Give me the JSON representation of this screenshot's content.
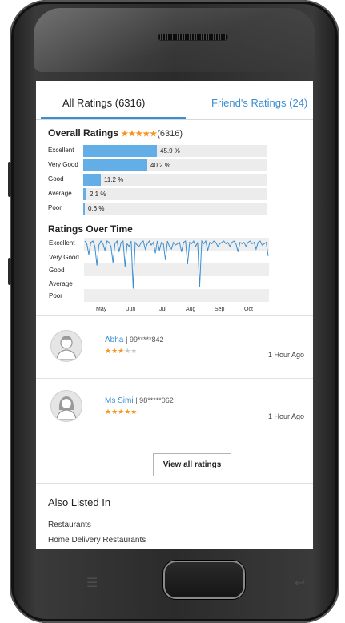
{
  "tabs": {
    "all_ratings": "All Ratings (6316)",
    "friends_ratings": "Friend's Ratings (24)"
  },
  "overall": {
    "title": "Overall Ratings",
    "stars": "★★★★★",
    "count": "(6316)",
    "bars": [
      {
        "label": "Excellent",
        "value": 45.9,
        "value_text": "45.9 %"
      },
      {
        "label": "Very Good",
        "value": 40.2,
        "value_text": "40.2 %"
      },
      {
        "label": "Good",
        "value": 11.2,
        "value_text": "11.2 %"
      },
      {
        "label": "Average",
        "value": 2.1,
        "value_text": "2.1 %"
      },
      {
        "label": "Poor",
        "value": 0.6,
        "value_text": "0.6 %"
      }
    ]
  },
  "over_time": {
    "title": "Ratings Over Time",
    "levels": [
      "Excellent",
      "Very Good",
      "Good",
      "Average",
      "Poor"
    ],
    "months": [
      "May",
      "Jun",
      "Jul",
      "Aug",
      "Sep",
      "Oct"
    ]
  },
  "chart_data": {
    "type": "line",
    "title": "Ratings Over Time",
    "x_tick_labels": [
      "May",
      "Jun",
      "Jul",
      "Aug",
      "Sep",
      "Oct"
    ],
    "y_categories": [
      "Poor",
      "Average",
      "Good",
      "Very Good",
      "Excellent"
    ],
    "series": [
      {
        "values": [
          5,
          4.8,
          4,
          4.9,
          5,
          4.6,
          3.2,
          4.7,
          5,
          4.8,
          4.3,
          5,
          4.9,
          4.6,
          3.4,
          4.8,
          5,
          4.2,
          4.9,
          5,
          3.1,
          4.8,
          4.6,
          5,
          1.5,
          4.9,
          4.7,
          4.6,
          4.9,
          5,
          4.4,
          4.8,
          5,
          4.7,
          4.9,
          4.1,
          5,
          4.3,
          4.9,
          4.8,
          3.6,
          5,
          4.6,
          4.4,
          4.9,
          4.7,
          4.8,
          4.9,
          4.2,
          4.9,
          5,
          3.3,
          4.9,
          4.8,
          5,
          4.6,
          4.9,
          1.6,
          5,
          4.8,
          5,
          4.3,
          4.9,
          4.8,
          5,
          4.9,
          4.6,
          4.8,
          4.9,
          5,
          4.8,
          4.9,
          4.6,
          4.9,
          5,
          4.8,
          4.2,
          4.9,
          4.8,
          4.9,
          4.6,
          4.9,
          5,
          4.8,
          4.9,
          4.4,
          4.9,
          5,
          4.7,
          4.8,
          4.9,
          3.9
        ]
      }
    ]
  },
  "reviews": [
    {
      "name": "Abha",
      "phone": "| 99*****842",
      "stars_on": "★★★",
      "stars_off": "★★",
      "time": "1 Hour Ago"
    },
    {
      "name": "Ms Simi",
      "phone": "| 98*****062",
      "stars_on": "★★★★★",
      "stars_off": "",
      "time": "1 Hour Ago"
    }
  ],
  "view_all_label": "View all ratings",
  "also_listed": {
    "title": "Also Listed In",
    "items": [
      "Restaurants",
      "Home Delivery Restaurants"
    ]
  },
  "colors": {
    "accent": "#3a8fd2",
    "bar": "#63aee6",
    "star": "#f7941d"
  }
}
